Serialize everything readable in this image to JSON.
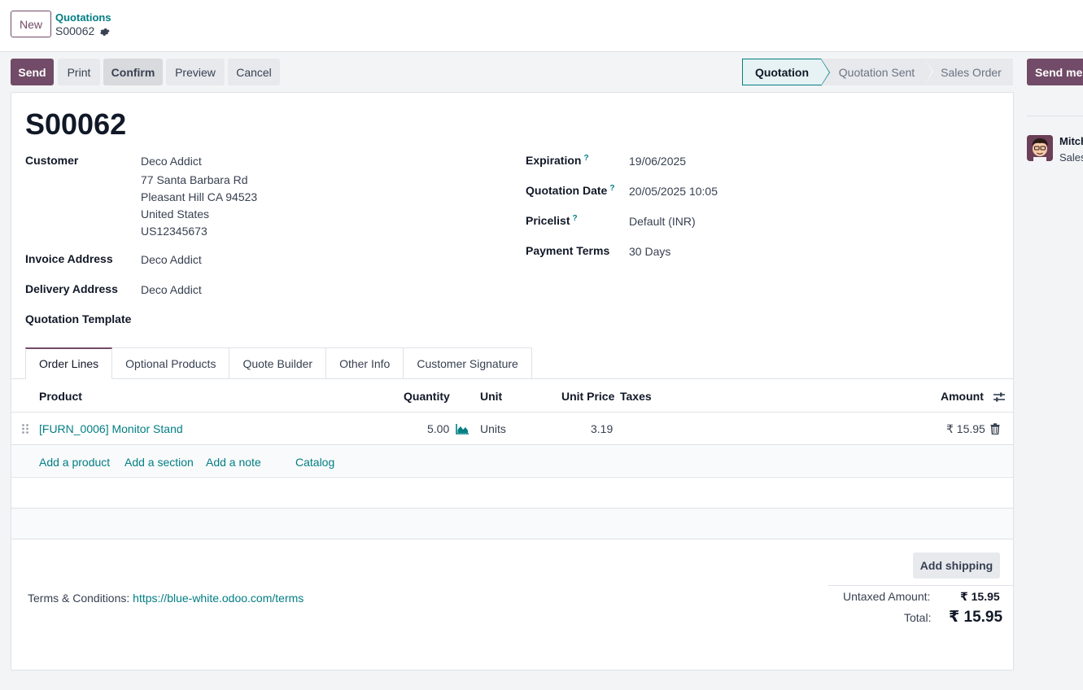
{
  "header": {
    "new_label": "New",
    "breadcrumb": "Quotations",
    "record_name": "S00062"
  },
  "actions": {
    "send": "Send",
    "print": "Print",
    "confirm": "Confirm",
    "preview": "Preview",
    "cancel": "Cancel",
    "send_message": "Send message"
  },
  "statusbar": {
    "stages": [
      "Quotation",
      "Quotation Sent",
      "Sales Order"
    ],
    "active": "Quotation"
  },
  "form": {
    "title": "S00062",
    "customer_label": "Customer",
    "customer_lines": [
      "Deco Addict",
      "77 Santa Barbara Rd",
      "Pleasant Hill CA 94523",
      "United States",
      "US12345673"
    ],
    "invoice_address_label": "Invoice Address",
    "invoice_address": "Deco Addict",
    "delivery_address_label": "Delivery Address",
    "delivery_address": "Deco Addict",
    "quotation_template_label": "Quotation Template",
    "expiration_label": "Expiration",
    "expiration": "19/06/2025",
    "quotation_date_label": "Quotation Date",
    "quotation_date": "20/05/2025 10:05",
    "pricelist_label": "Pricelist",
    "pricelist": "Default (INR)",
    "payment_terms_label": "Payment Terms",
    "payment_terms": "30 Days",
    "help_mark": "?"
  },
  "tabs": [
    "Order Lines",
    "Optional Products",
    "Quote Builder",
    "Other Info",
    "Customer Signature"
  ],
  "table": {
    "headers": {
      "product": "Product",
      "quantity": "Quantity",
      "unit": "Unit",
      "unit_price": "Unit Price",
      "taxes": "Taxes",
      "amount": "Amount"
    },
    "rows": [
      {
        "product": "[FURN_0006] Monitor Stand",
        "quantity": "5.00",
        "unit": "Units",
        "unit_price": "3.19",
        "taxes": "",
        "amount": "₹ 15.95"
      }
    ],
    "add_product": "Add a product",
    "add_section": "Add a section",
    "add_note": "Add a note",
    "catalog": "Catalog"
  },
  "footer": {
    "add_shipping": "Add shipping",
    "terms_label": "Terms & Conditions:",
    "terms_link": "https://blue-white.odoo.com/terms",
    "untaxed_label": "Untaxed Amount:",
    "untaxed_value": "₹ 15.95",
    "total_label": "Total:",
    "total_value": "₹ 15.95"
  },
  "chatter": {
    "name": "Mitchell Admin",
    "subtitle": "Sales"
  },
  "colors": {
    "primary": "#714b67",
    "link": "#017e84"
  }
}
